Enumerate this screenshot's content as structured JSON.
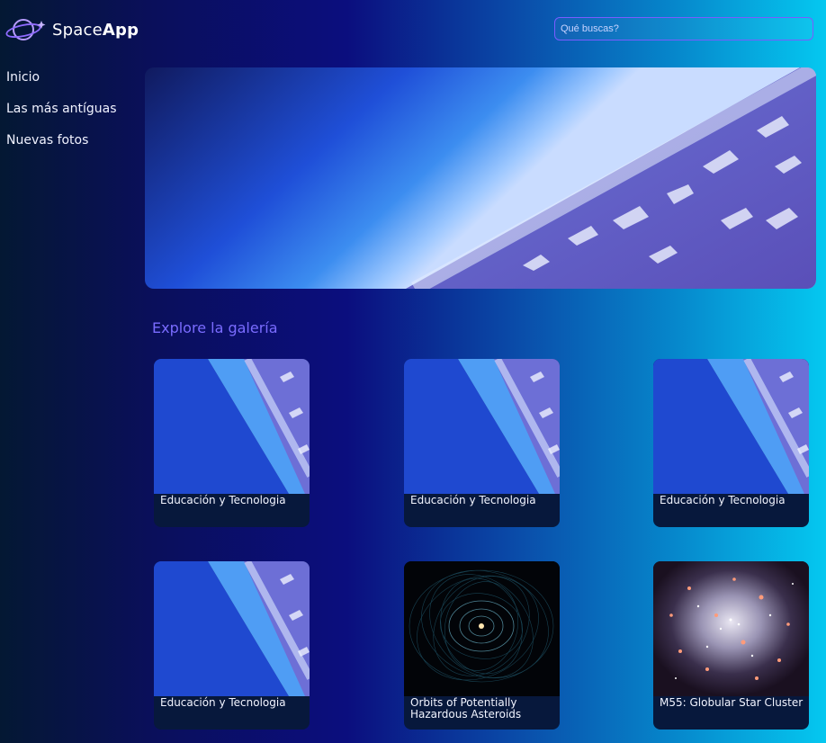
{
  "header": {
    "logo_text_light": "Space",
    "logo_text_bold": "App",
    "search_placeholder": "Qué buscas?"
  },
  "sidebar": {
    "items": [
      {
        "label": "Inicio"
      },
      {
        "label": "Las más antíguas"
      },
      {
        "label": "Nuevas fotos"
      }
    ]
  },
  "gallery": {
    "title": "Explore la galería",
    "cards": [
      {
        "caption": "Educación y Tecnologia",
        "image": "earth-atmosphere"
      },
      {
        "caption": "Educación y Tecnologia",
        "image": "earth-atmosphere"
      },
      {
        "caption": "Educación y Tecnologia",
        "image": "earth-atmosphere"
      },
      {
        "caption": "Educación y Tecnologia",
        "image": "earth-atmosphere"
      },
      {
        "caption": "Orbits of Potentially Hazardous Asteroids",
        "image": "asteroid-orbits"
      },
      {
        "caption": "M55: Globular Star Cluster",
        "image": "star-cluster"
      }
    ]
  },
  "colors": {
    "accent": "#7a5cff",
    "gallery_title": "#7a6cff",
    "card_bg": "#07183c"
  }
}
